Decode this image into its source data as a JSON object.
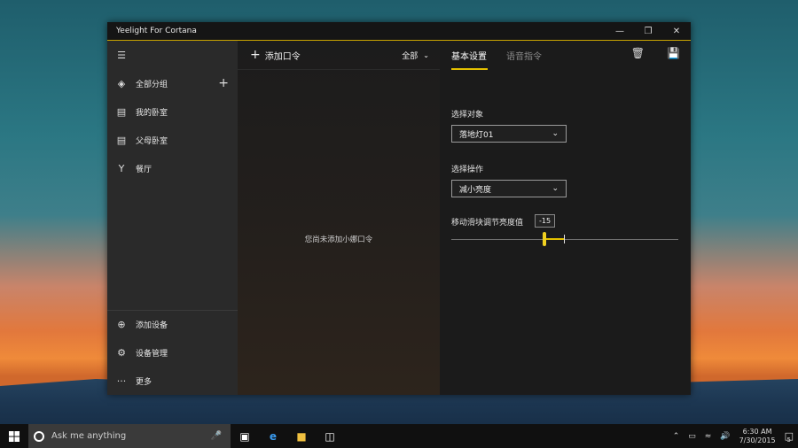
{
  "window": {
    "title": "Yeelight For Cortana"
  },
  "sidebar": {
    "items": [
      {
        "label": "全部分组",
        "icon": "layers-icon"
      },
      {
        "label": "我的卧室",
        "icon": "bed-icon"
      },
      {
        "label": "父母卧室",
        "icon": "bed-icon"
      },
      {
        "label": "餐厅",
        "icon": "dining-icon"
      }
    ],
    "bottom_items": [
      {
        "label": "添加设备",
        "icon": "add-circle-icon"
      },
      {
        "label": "设备管理",
        "icon": "gear-icon"
      },
      {
        "label": "更多",
        "icon": "more-icon"
      }
    ]
  },
  "middle": {
    "add_label": "添加口令",
    "filter_label": "全部",
    "empty_text": "您尚未添加小娜口令"
  },
  "right": {
    "tabs": [
      "基本设置",
      "语音指令"
    ],
    "target_label": "选择对象",
    "target_value": "落地灯01",
    "action_label": "选择操作",
    "action_value": "减小亮度",
    "slider_label": "移动滑块调节亮度值",
    "slider_value": "-15"
  },
  "taskbar": {
    "search_placeholder": "Ask me anything",
    "time": "6:30 AM",
    "date": "7/30/2015",
    "notifications": "5"
  },
  "colors": {
    "accent": "#e3c000",
    "sidebar_bg": "#2a2a2a",
    "panel_bg": "#1b1b1b"
  }
}
